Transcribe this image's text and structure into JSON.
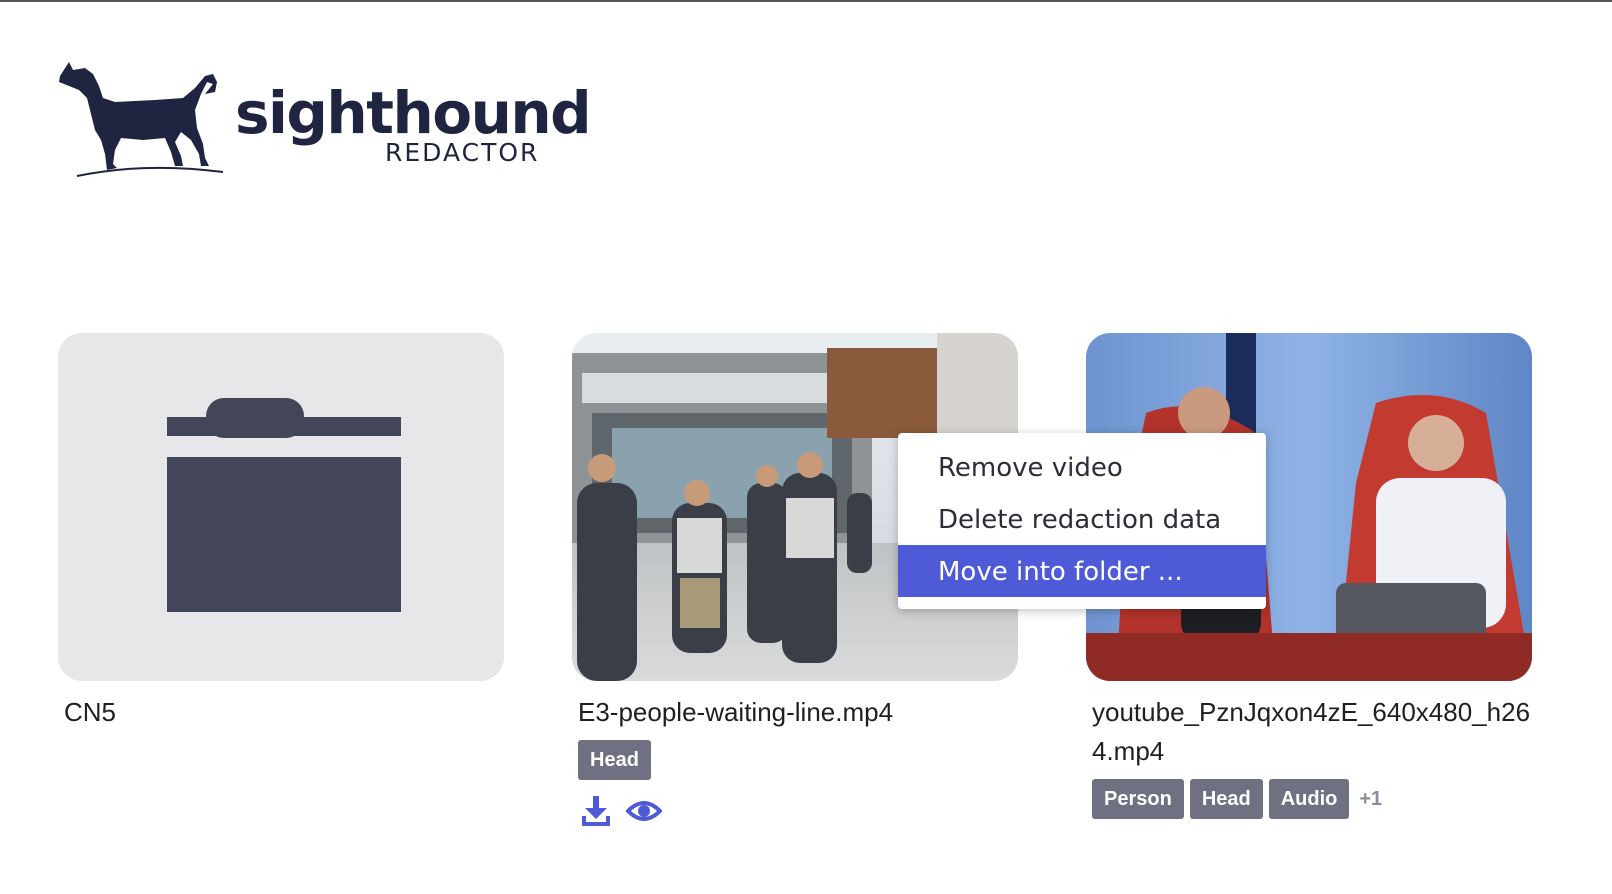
{
  "logo": {
    "wordmark": "sighthound",
    "subtitle": "REDACTOR",
    "color": "#1f2440"
  },
  "cards": [
    {
      "kind": "folder",
      "title": "CN5",
      "icon": "folder-icon"
    },
    {
      "kind": "video",
      "title": "E3-people-waiting-line.mp4",
      "tags": [
        "Head"
      ],
      "actions": [
        "download-icon",
        "eye-icon"
      ]
    },
    {
      "kind": "video",
      "title": "youtube_PznJqxon4zE_640x480_h264.mp4",
      "tags": [
        "Person",
        "Head",
        "Audio"
      ],
      "more": "+1"
    }
  ],
  "context_menu": {
    "items": [
      {
        "label": "Remove video"
      },
      {
        "label": "Delete redaction data"
      },
      {
        "label": "Move into folder ..."
      }
    ],
    "highlighted_index": 2
  },
  "colors": {
    "accent": "#4e5ad6",
    "tag_bg": "#6f7182",
    "folder_tile": "#e7e7ea",
    "folder_icon": "#434558"
  }
}
